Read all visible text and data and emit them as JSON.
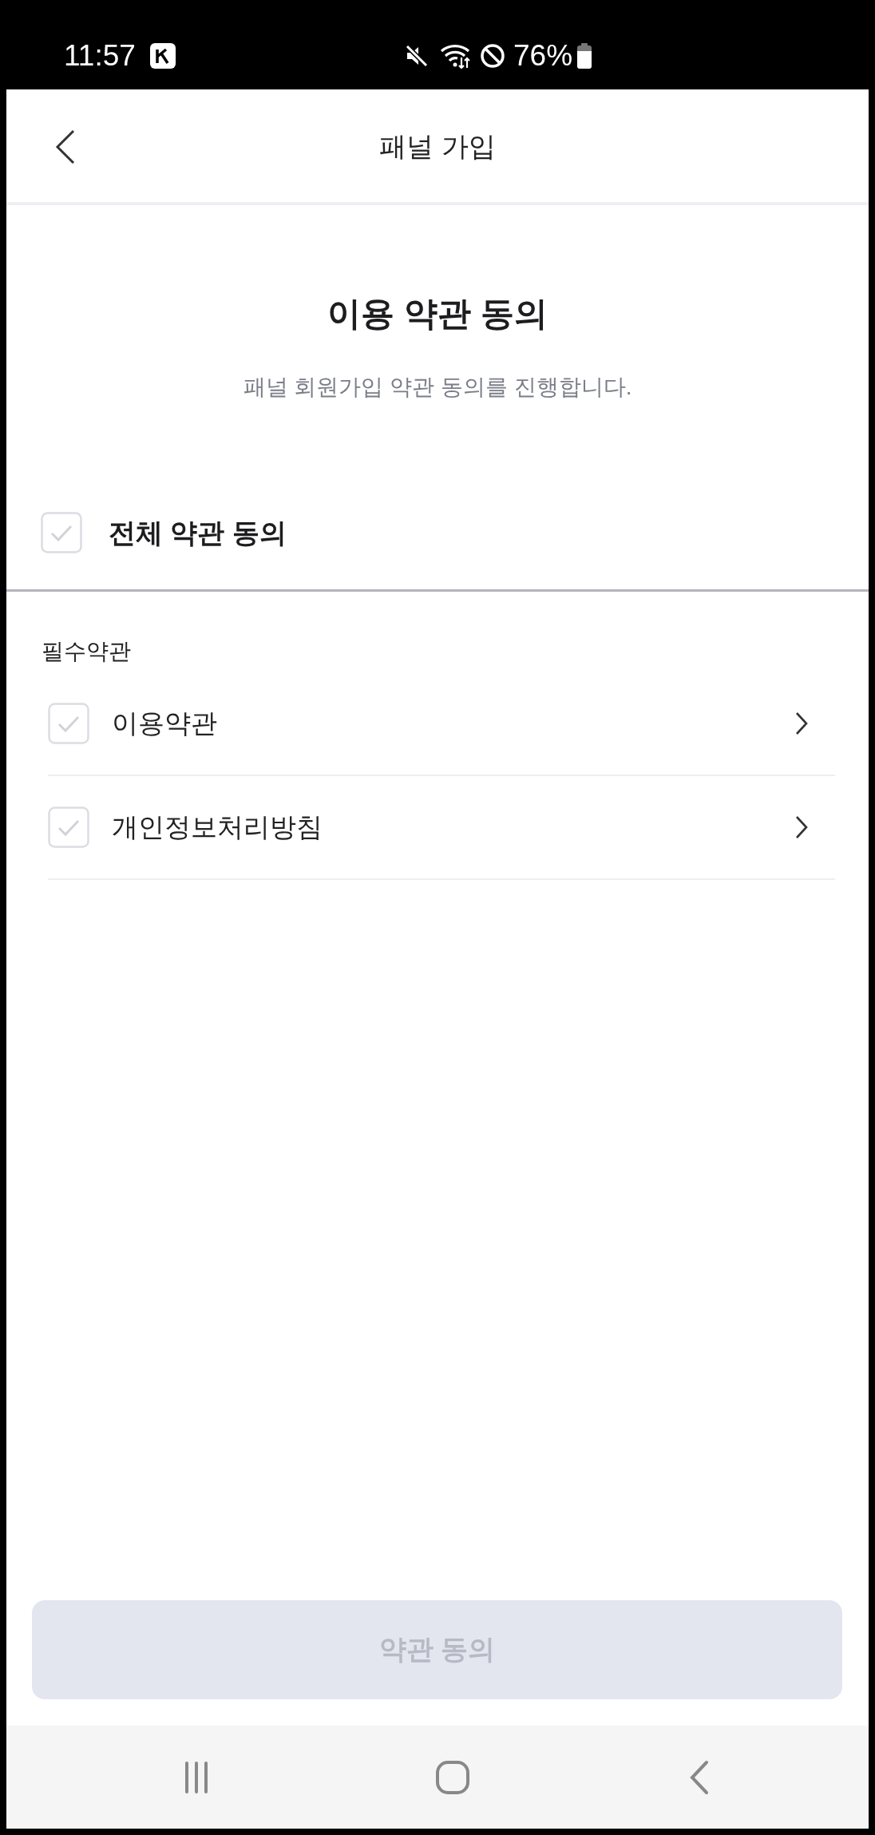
{
  "status_bar": {
    "time": "11:57",
    "battery": "76%"
  },
  "header": {
    "title": "패널 가입"
  },
  "intro": {
    "title": "이용 약관 동의",
    "subtitle": "패널 회원가입 약관 동의를 진행합니다."
  },
  "agree_all": {
    "label": "전체 약관 동의",
    "checked": false
  },
  "required_section": {
    "heading": "필수약관",
    "items": [
      {
        "label": "이용약관",
        "checked": false
      },
      {
        "label": "개인정보처리방침",
        "checked": false
      }
    ]
  },
  "submit_button": {
    "label": "약관 동의",
    "disabled": true
  }
}
